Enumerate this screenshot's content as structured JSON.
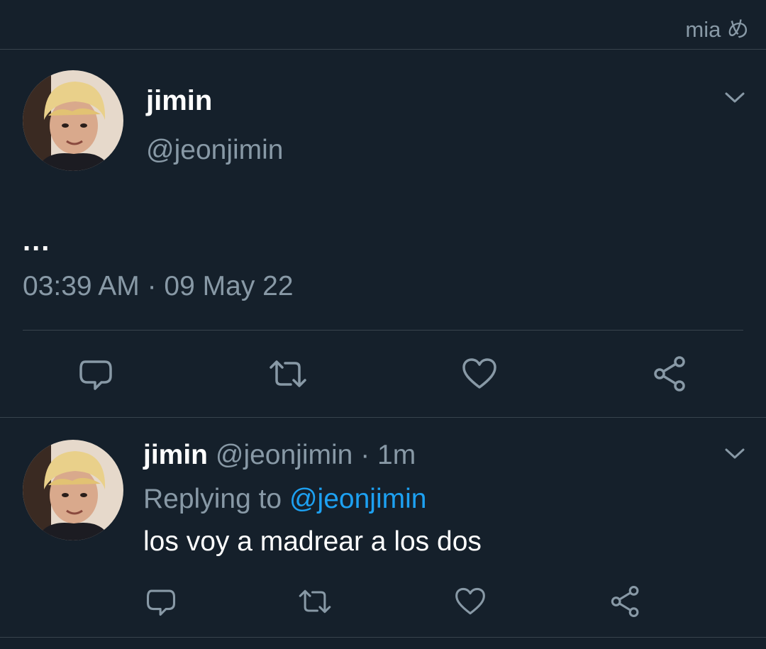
{
  "watermark": "mia め",
  "tweet": {
    "name": "jimin",
    "handle": "@jeonjimin",
    "text": "...",
    "timestamp": "03:39 AM · 09 May 22",
    "actions": [
      "reply-icon",
      "retweet-icon",
      "like-icon",
      "share-icon"
    ]
  },
  "reply": {
    "name": "jimin",
    "handle": "@jeonjimin",
    "time_separator": " · ",
    "time": "1m",
    "replying_prefix": "Replying to ",
    "replying_to": "@jeonjimin",
    "text": "los voy a madrear a los dos",
    "actions": [
      "reply-icon",
      "retweet-icon",
      "like-icon",
      "share-icon"
    ]
  },
  "colors": {
    "background": "#15202b",
    "muted": "#8899a6",
    "link": "#1da1f2",
    "divider": "#38444d"
  }
}
